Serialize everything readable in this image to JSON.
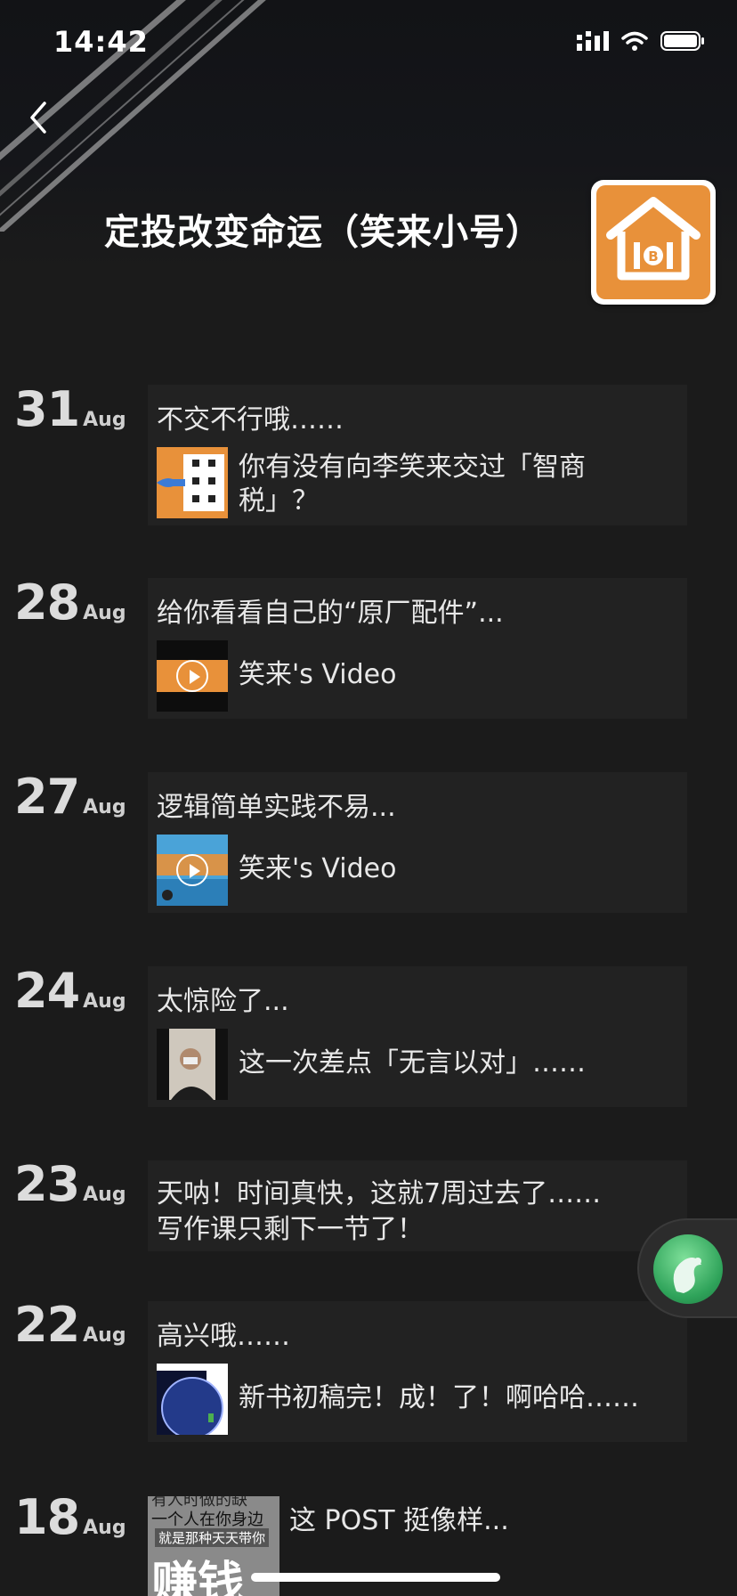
{
  "status": {
    "time": "14:42"
  },
  "header": {
    "title": "定投改变命运（笑来小号）"
  },
  "entries": [
    {
      "day": "31",
      "month": "Aug",
      "caption": "不交不行哦……",
      "text": "你有没有向李笑来交过「智商税」？"
    },
    {
      "day": "28",
      "month": "Aug",
      "caption": "给你看看自己的“原厂配件”...",
      "text": "笑来's Video"
    },
    {
      "day": "27",
      "month": "Aug",
      "caption": "逻辑简单实践不易...",
      "text": "笑来's Video"
    },
    {
      "day": "24",
      "month": "Aug",
      "caption": "太惊险了...",
      "text": "这一次差点「无言以对」……"
    },
    {
      "day": "23",
      "month": "Aug",
      "caption": "天呐！时间真快，这就7周过去了……",
      "caption2": "写作课只剩下一节了！"
    },
    {
      "day": "22",
      "month": "Aug",
      "caption": "高兴哦……",
      "text": "新书初稿完！成！了！啊哈哈……"
    },
    {
      "day": "18",
      "month": "Aug",
      "text": "这 POST 挺像样...",
      "thumb_lines": [
        "有人时做的缺",
        "一个人在你身边",
        "就是那种天天带你",
        "赚钱"
      ]
    }
  ],
  "colors": {
    "accent_orange": "#E8913A",
    "background": "#1b1b1b",
    "card": "#222222"
  }
}
